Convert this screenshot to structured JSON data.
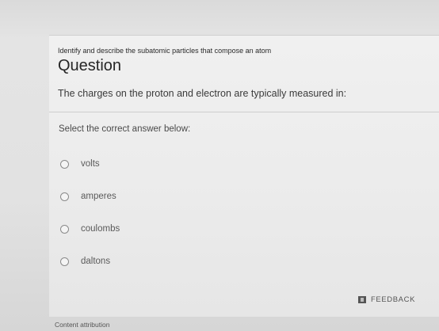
{
  "question": {
    "topic": "Identify and describe the subatomic particles that compose an atom",
    "heading": "Question",
    "text": "The charges on the proton and electron are typically measured in:",
    "prompt": "Select the correct answer below:",
    "options": [
      {
        "label": "volts"
      },
      {
        "label": "amperes"
      },
      {
        "label": "coulombs"
      },
      {
        "label": "daltons"
      }
    ]
  },
  "footer": {
    "feedback_label": "FEEDBACK",
    "feedback_icon": "feedback-icon",
    "attribution": "Content attribution"
  }
}
